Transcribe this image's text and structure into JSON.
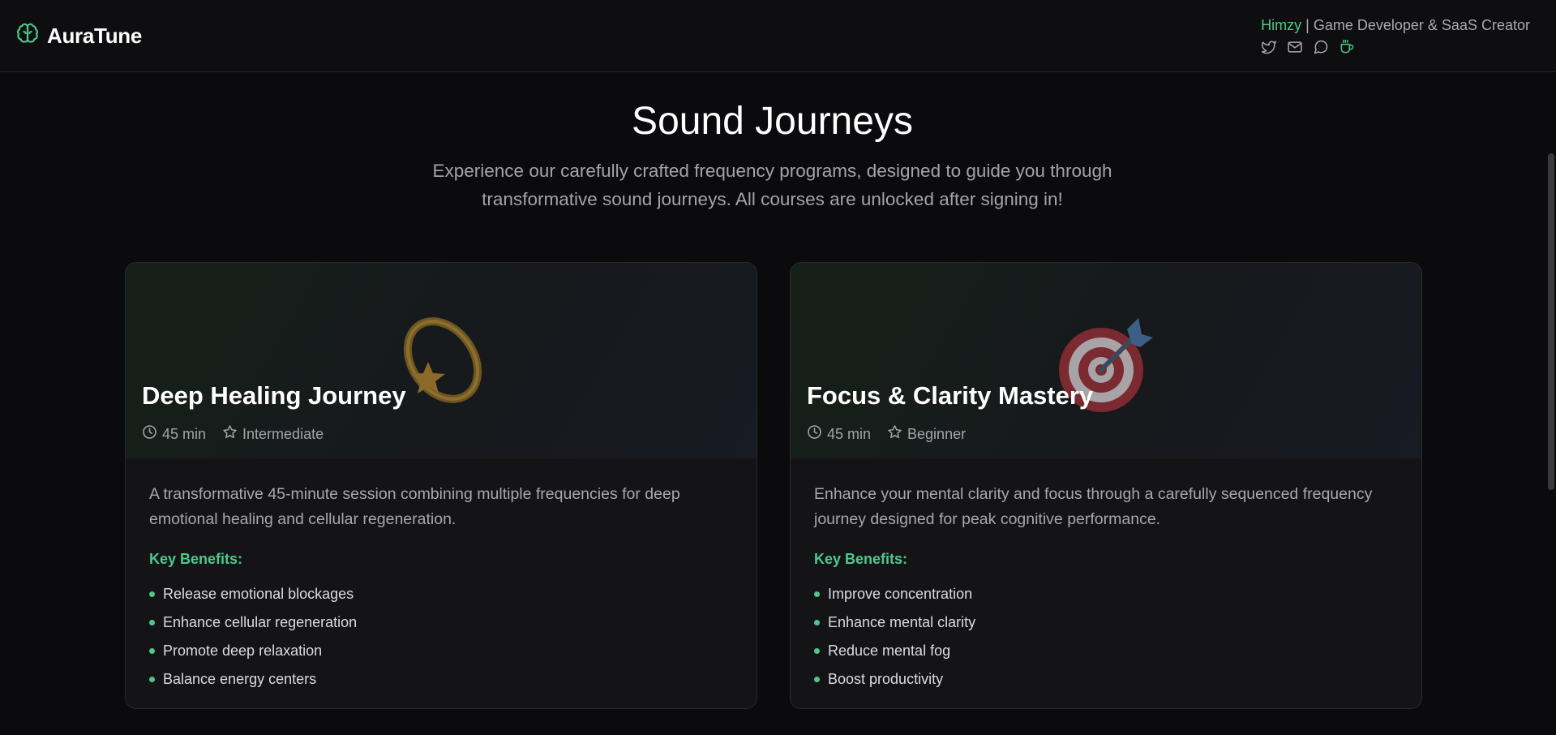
{
  "app": {
    "brand": "AuraTune",
    "brand_icon": "brain-icon",
    "accent_color": "#4cc98a"
  },
  "author": {
    "name": "Himzy",
    "separator": "|",
    "role": "Game Developer & SaaS Creator",
    "links": [
      {
        "icon": "twitter-icon"
      },
      {
        "icon": "mail-icon"
      },
      {
        "icon": "chat-icon"
      },
      {
        "icon": "coffee-icon"
      }
    ]
  },
  "main": {
    "title": "Sound Journeys",
    "subtitle": "Experience our carefully crafted frequency programs, designed to guide you through transformative sound journeys. All courses are unlocked after signing in!"
  },
  "courses": [
    {
      "emoji": "dizzy-star-icon",
      "title": "Deep Healing Journey",
      "duration": "45 min",
      "level": "Intermediate",
      "description": "A transformative 45-minute session combining multiple frequencies for deep emotional healing and cellular regeneration.",
      "benefits_label": "Key Benefits:",
      "benefits": [
        "Release emotional blockages",
        "Enhance cellular regeneration",
        "Promote deep relaxation",
        "Balance energy centers"
      ]
    },
    {
      "emoji": "target-dart-icon",
      "title": "Focus & Clarity Mastery",
      "duration": "45 min",
      "level": "Beginner",
      "description": "Enhance your mental clarity and focus through a carefully sequenced frequency journey designed for peak cognitive performance.",
      "benefits_label": "Key Benefits:",
      "benefits": [
        "Improve concentration",
        "Enhance mental clarity",
        "Reduce mental fog",
        "Boost productivity"
      ]
    }
  ]
}
